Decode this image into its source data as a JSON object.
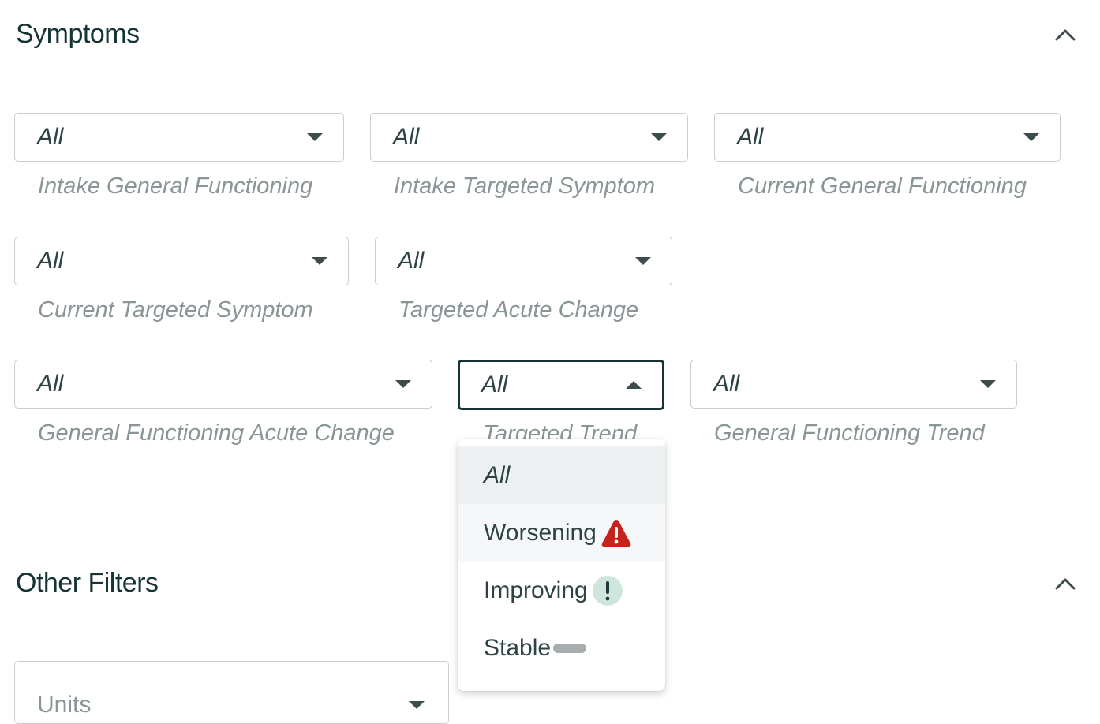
{
  "symptoms": {
    "title": "Symptoms",
    "filters": [
      {
        "value": "All",
        "label": "Intake General Functioning"
      },
      {
        "value": "All",
        "label": "Intake Targeted Symptom"
      },
      {
        "value": "All",
        "label": "Current General Functioning"
      },
      {
        "value": "All",
        "label": "Current Targeted Symptom"
      },
      {
        "value": "All",
        "label": "Targeted Acute Change"
      },
      {
        "value": "All",
        "label": "General Functioning Acute Change"
      },
      {
        "value": "All",
        "label": "Targeted Trend"
      },
      {
        "value": "All",
        "label": "General Functioning Trend"
      }
    ]
  },
  "dropdown": {
    "options": [
      {
        "label": "All",
        "icon": ""
      },
      {
        "label": "Worsening",
        "icon": "warning-triangle-icon"
      },
      {
        "label": "Improving",
        "icon": "exclamation-circle-icon"
      },
      {
        "label": "Stable",
        "icon": "dash-pill-icon"
      }
    ]
  },
  "other_filters": {
    "title": "Other Filters",
    "units_placeholder": "Units"
  },
  "colors": {
    "heading": "#163436",
    "label": "#8a9597",
    "border": "#c9cfd1",
    "open_border": "#163436",
    "worsening": "#c4241c",
    "improving_bg": "#cfe6df",
    "improving_fg": "#1f3a3c",
    "stable": "#a7acae"
  }
}
